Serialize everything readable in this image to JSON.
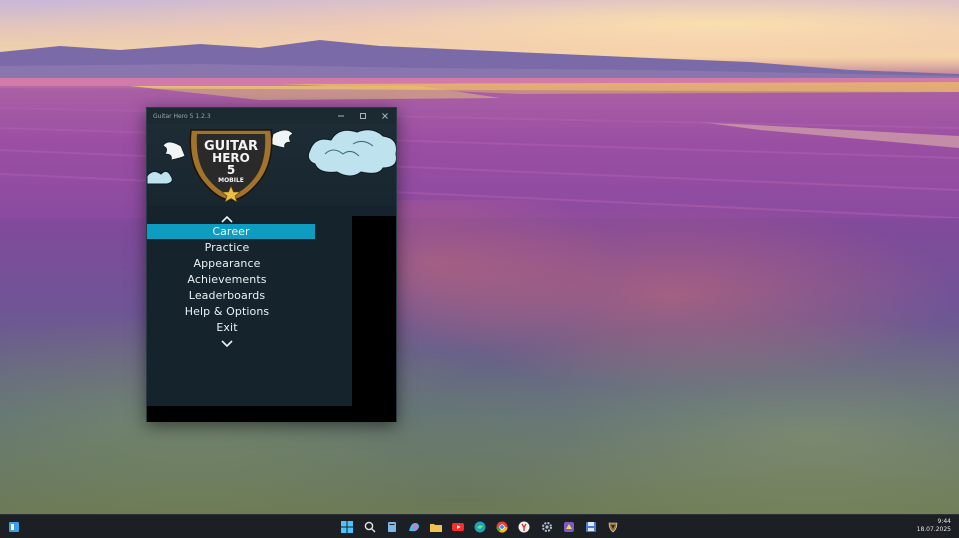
{
  "window": {
    "title": "Guitar Hero 5 1.2.3",
    "logo_line1": "GUITAR",
    "logo_line2": "HERO",
    "logo_number": "5",
    "logo_sub": "MOBILE"
  },
  "menu": {
    "items": [
      {
        "label": "Career",
        "selected": true
      },
      {
        "label": "Practice",
        "selected": false
      },
      {
        "label": "Appearance",
        "selected": false
      },
      {
        "label": "Achievements",
        "selected": false
      },
      {
        "label": "Leaderboards",
        "selected": false
      },
      {
        "label": "Help & Options",
        "selected": false
      },
      {
        "label": "Exit",
        "selected": false
      }
    ]
  },
  "taskbar": {
    "time": "9:44",
    "date": "18.07.2025",
    "apps": [
      "start-icon",
      "search-icon",
      "files-icon",
      "copilot-icon",
      "file-explorer-icon",
      "youtube-icon",
      "edge-icon",
      "chrome-icon",
      "yandex-icon",
      "settings-icon",
      "app-icon",
      "save-icon",
      "guitar-hero-icon"
    ]
  },
  "colors": {
    "accent": "#0f9cc1",
    "window_bg": "#14232c",
    "taskbar_bg": "#1c1f24"
  }
}
